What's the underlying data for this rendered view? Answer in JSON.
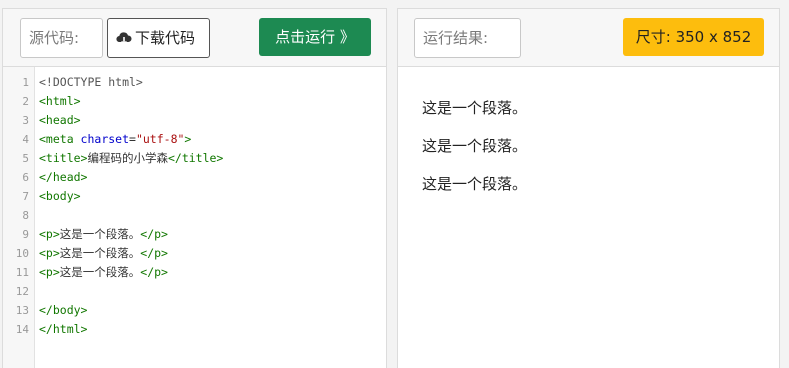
{
  "editor": {
    "source_label": "源代码:",
    "download_label": "下载代码",
    "run_label": "点击运行 》",
    "lines": [
      {
        "n": "1",
        "parts": [
          {
            "t": "<!DOCTYPE html>",
            "c": "doctype"
          }
        ]
      },
      {
        "n": "2",
        "parts": [
          {
            "t": "<html>",
            "c": "tag"
          }
        ]
      },
      {
        "n": "3",
        "parts": [
          {
            "t": "<head>",
            "c": "tag"
          }
        ]
      },
      {
        "n": "4",
        "parts": [
          {
            "t": "<meta ",
            "c": "tag"
          },
          {
            "t": "charset",
            "c": "attr"
          },
          {
            "t": "=",
            "c": "plain"
          },
          {
            "t": "\"utf-8\"",
            "c": "str"
          },
          {
            "t": ">",
            "c": "tag"
          }
        ]
      },
      {
        "n": "5",
        "parts": [
          {
            "t": "<title>",
            "c": "tag"
          },
          {
            "t": "编程码的小学森",
            "c": "plain"
          },
          {
            "t": "</title>",
            "c": "tag"
          }
        ]
      },
      {
        "n": "6",
        "parts": [
          {
            "t": "</head>",
            "c": "tag"
          }
        ]
      },
      {
        "n": "7",
        "parts": [
          {
            "t": "<body>",
            "c": "tag"
          }
        ]
      },
      {
        "n": "8",
        "parts": []
      },
      {
        "n": "9",
        "parts": [
          {
            "t": "<p>",
            "c": "tag"
          },
          {
            "t": "这是一个段落。",
            "c": "plain"
          },
          {
            "t": "</p>",
            "c": "tag"
          }
        ]
      },
      {
        "n": "10",
        "parts": [
          {
            "t": "<p>",
            "c": "tag"
          },
          {
            "t": "这是一个段落。",
            "c": "plain"
          },
          {
            "t": "</p>",
            "c": "tag"
          }
        ]
      },
      {
        "n": "11",
        "parts": [
          {
            "t": "<p>",
            "c": "tag"
          },
          {
            "t": "这是一个段落。",
            "c": "plain"
          },
          {
            "t": "</p>",
            "c": "tag"
          }
        ]
      },
      {
        "n": "12",
        "parts": []
      },
      {
        "n": "13",
        "parts": [
          {
            "t": "</body>",
            "c": "tag"
          }
        ]
      },
      {
        "n": "14",
        "parts": [
          {
            "t": "</html>",
            "c": "tag"
          }
        ]
      }
    ]
  },
  "result": {
    "label": "运行结果:",
    "size_badge": "尺寸: 350 x 852",
    "paragraphs": [
      "这是一个段落。",
      "这是一个段落。",
      "这是一个段落。"
    ]
  },
  "icons": {
    "download": "cloud-download-icon"
  },
  "colors": {
    "run_button": "#1d8a52",
    "size_badge": "#fdbd0d"
  }
}
